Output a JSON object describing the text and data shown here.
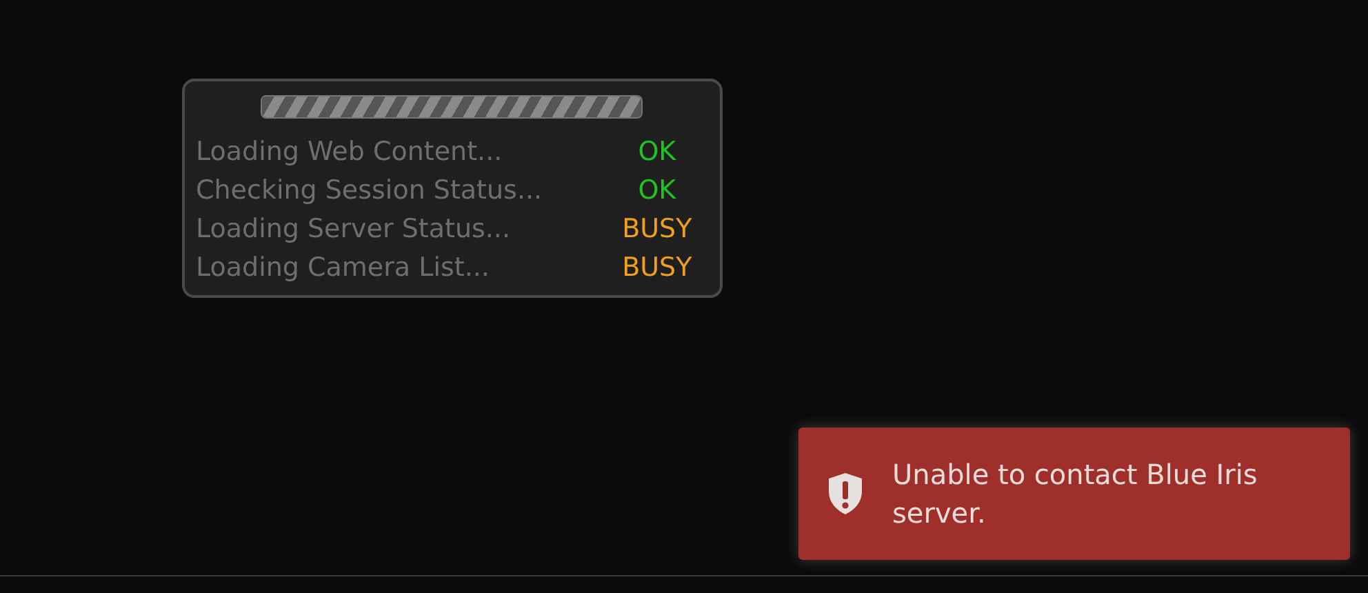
{
  "loader": {
    "progress": {
      "level": 1
    },
    "items": [
      {
        "label": "Loading Web Content...",
        "status": "OK",
        "kind": "ok"
      },
      {
        "label": "Checking Session Status...",
        "status": "OK",
        "kind": "ok"
      },
      {
        "label": "Loading Server Status...",
        "status": "BUSY",
        "kind": "busy"
      },
      {
        "label": "Loading Camera List...",
        "status": "BUSY",
        "kind": "busy"
      }
    ]
  },
  "toast": {
    "message": "Unable to contact Blue Iris server."
  }
}
